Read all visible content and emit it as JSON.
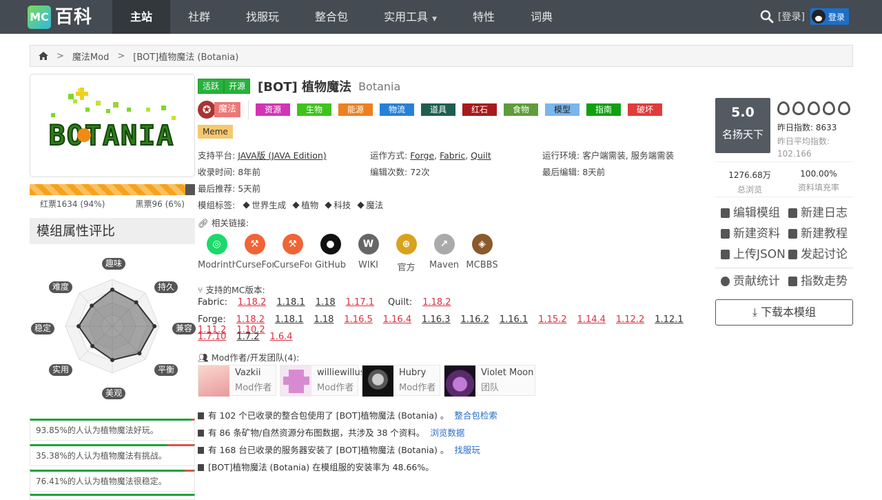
{
  "nav": {
    "logo_mc": "MC",
    "logo_text": "百科",
    "items": [
      {
        "label": "主站"
      },
      {
        "label": "社群"
      },
      {
        "label": "找服玩"
      },
      {
        "label": "整合包"
      },
      {
        "label": "实用工具"
      },
      {
        "label": "特性"
      },
      {
        "label": "词典"
      }
    ],
    "login_text": "[登录]",
    "qq_login": "登录",
    "icons": [
      "search-icon",
      "chevron-down-icon",
      "qq-icon"
    ]
  },
  "breadcrumb": {
    "items": [
      "魔法Mod",
      "[BOT]植物魔法 (Botania)"
    ],
    "separator": ">"
  },
  "mod": {
    "badges": [
      "活跃",
      "开源"
    ],
    "title": "[BOT] 植物魔法",
    "title_en": "Botania",
    "category": "魔法",
    "tags": [
      {
        "label": "资源",
        "color": "#d434b4"
      },
      {
        "label": "生物",
        "color": "#3ec31b"
      },
      {
        "label": "能源",
        "color": "#ee7f1f"
      },
      {
        "label": "物流",
        "color": "#2780d8"
      },
      {
        "label": "道具",
        "color": "#1e5f4f"
      },
      {
        "label": "红石",
        "color": "#a81a1a"
      },
      {
        "label": "食物",
        "color": "#5f9c3b"
      },
      {
        "label": "模型",
        "color": "#7ab5ec"
      },
      {
        "label": "指南",
        "color": "#0fa10f"
      },
      {
        "label": "破坏",
        "color": "#e23b3b"
      }
    ],
    "meme": "Meme",
    "info": {
      "platform_label": "支持平台:",
      "platform_value": "JAVA版 (JAVA Edition)",
      "run_label": "运作方式:",
      "run_values": [
        "Forge",
        "Fabric",
        "Quilt"
      ],
      "env_label": "运行环境:",
      "env_value": "客户端需装, 服务端需装",
      "collected_label": "收录时间:",
      "collected_value": "8年前",
      "edits_label": "编辑次数:",
      "edits_value": "72次",
      "last_edit_label": "最后编辑:",
      "last_edit_value": "8天前",
      "recommend_label": "最后推荐:",
      "recommend_value": "5天前",
      "modtags_label": "模组标签:",
      "modtags": [
        "世界生成",
        "植物",
        "科技",
        "魔法"
      ]
    },
    "links_label": "相关链接:",
    "links": [
      {
        "label": "Modrinth",
        "color": "#1bd96a",
        "glyph": "◎"
      },
      {
        "label": "CurseForge",
        "color": "#f16436",
        "glyph": "⚒"
      },
      {
        "label": "CurseForge",
        "color": "#f16436",
        "glyph": "⚒"
      },
      {
        "label": "GitHub",
        "color": "#111111",
        "glyph": "●"
      },
      {
        "label": "WIKI",
        "color": "#666666",
        "glyph": "W"
      },
      {
        "label": "官方",
        "color": "#d8a21c",
        "glyph": "⊕"
      },
      {
        "label": "Maven",
        "color": "#aaaaaa",
        "glyph": "↗"
      },
      {
        "label": "MCBBS",
        "color": "#8a5a2b",
        "glyph": "◈"
      }
    ],
    "versions_label": "支持的MC版本:",
    "fabric_label": "Fabric:",
    "fabric_versions": [
      {
        "v": "1.18.2",
        "c": "red"
      },
      {
        "v": "1.18.1",
        "c": "black"
      },
      {
        "v": "1.18",
        "c": "black"
      },
      {
        "v": "1.17.1",
        "c": "red"
      }
    ],
    "quilt_label": "Quilt:",
    "quilt_versions": [
      {
        "v": "1.18.2",
        "c": "red"
      }
    ],
    "forge_label": "Forge:",
    "forge_versions": [
      {
        "v": "1.18.2",
        "c": "red"
      },
      {
        "v": "1.18.1",
        "c": "black"
      },
      {
        "v": "1.18",
        "c": "black"
      },
      {
        "v": "1.16.5",
        "c": "red"
      },
      {
        "v": "1.16.4",
        "c": "red"
      },
      {
        "v": "1.16.3",
        "c": "black"
      },
      {
        "v": "1.16.2",
        "c": "black"
      },
      {
        "v": "1.16.1",
        "c": "black"
      },
      {
        "v": "1.15.2",
        "c": "red"
      },
      {
        "v": "1.14.4",
        "c": "red"
      },
      {
        "v": "1.12.2",
        "c": "red"
      },
      {
        "v": "1.12.1",
        "c": "black"
      },
      {
        "v": "1.11.2",
        "c": "red"
      },
      {
        "v": "1.10.2",
        "c": "red"
      }
    ],
    "forge_versions_2": [
      {
        "v": "1.7.10",
        "c": "red"
      },
      {
        "v": "1.7.2",
        "c": "black"
      },
      {
        "v": "1.6.4",
        "c": "red"
      }
    ],
    "authors_label": "Mod作者/开发团队(4):",
    "authors": [
      {
        "name": "Vazkii",
        "role": "Mod作者",
        "color": "#f4c4c4"
      },
      {
        "name": "williewillus",
        "role": "Mod作者",
        "color": "#d88ad0"
      },
      {
        "name": "Hubry",
        "role": "Mod作者",
        "color": "#222222"
      },
      {
        "name": "Violet Moon",
        "role": "团队",
        "color": "#4a2a5a"
      }
    ],
    "stats": [
      {
        "text": "有 102 个已收录的整合包使用了 [BOT]植物魔法 (Botania) 。",
        "link": "整合包检索"
      },
      {
        "text": "有 86 条矿物/自然资源分布图数据，共涉及 38 个资料。",
        "link": "浏览数据"
      },
      {
        "text": "有 168 台已收录的服务器安装了 [BOT]植物魔法 (Botania) 。",
        "link": "找服玩"
      },
      {
        "text": "[BOT]植物魔法 (Botania) 在模组服的安装率为 48.66%。",
        "link": ""
      }
    ]
  },
  "left": {
    "cover_text": "BOTANIA",
    "red_votes": "红票1634 (94%)",
    "black_votes": "黑票96 (6%)",
    "red_ratio": 0.94,
    "eval_title": "模组属性评比",
    "radar_labels": [
      "趣味",
      "持久",
      "兼容",
      "平衡",
      "美观",
      "实用",
      "稳定",
      "难度"
    ],
    "radar_values": [
      0.78,
      0.72,
      0.9,
      0.82,
      0.72,
      0.6,
      0.72,
      0.62
    ],
    "opinions": [
      {
        "text": "93.85%的人认为植物魔法好玩。",
        "good": 0.9385
      },
      {
        "text": "35.38%的人认为植物魔法有挑战。",
        "good": 0.3538
      },
      {
        "text": "76.41%的人认为植物魔法很稳定。",
        "good": 0.7641
      }
    ]
  },
  "right": {
    "score": "5.0",
    "score_word": "名扬天下",
    "flame_count": 5,
    "yesterday_index": "昨日指数: 8633",
    "yesterday_avg_label": "昨日平均指数:",
    "yesterday_avg": "102.166",
    "views": "1276.68万",
    "views_label": "总浏览",
    "fill_rate": "100.00%",
    "fill_rate_label": "资料填充率",
    "actions": [
      [
        "编辑模组",
        "新建日志"
      ],
      [
        "新建资料",
        "新建教程"
      ],
      [
        "上传JSON",
        "发起讨论"
      ]
    ],
    "actions2": [
      "贡献统计",
      "指数走势"
    ],
    "download": "下载本模组"
  }
}
